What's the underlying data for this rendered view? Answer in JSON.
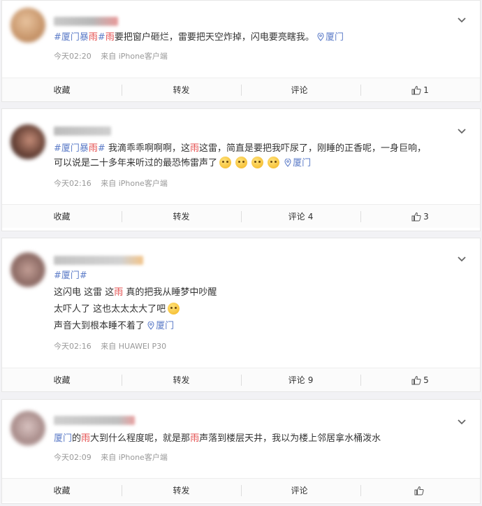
{
  "colors": {
    "tag": "#5e7dc8",
    "highlight": "#e34b4b",
    "meta": "#999999"
  },
  "posts": [
    {
      "segments": [
        {
          "t": "#厦门暴",
          "c": "tag"
        },
        {
          "t": "雨",
          "c": "hl"
        },
        {
          "t": "#",
          "c": "tag"
        },
        {
          "t": "雨",
          "c": "hl"
        },
        {
          "t": "要把窗户砸烂，雷要把天空炸掉，闪电要亮瞎我。",
          "c": ""
        }
      ],
      "location": "厦门",
      "time": "今天02:20",
      "source": "来自 iPhone客户端",
      "actions": {
        "favorite": "收藏",
        "repost": "转发",
        "comment": "评论",
        "comment_count": "",
        "like_count": "1"
      }
    },
    {
      "lines": [
        [
          {
            "t": "#厦门暴",
            "c": "tag"
          },
          {
            "t": "雨",
            "c": "hl"
          },
          {
            "t": "#",
            "c": "tag"
          },
          {
            "t": " 我滴乖乖啊啊啊，这",
            "c": ""
          },
          {
            "t": "雨",
            "c": "hl"
          },
          {
            "t": "这雷，简直是要把我吓尿了，刚睡的正香呢，一身巨响，",
            "c": ""
          }
        ],
        [
          {
            "t": "可以说是二十多年来听过的最恐怖雷声了",
            "c": ""
          }
        ]
      ],
      "location": "厦门",
      "time": "今天02:16",
      "source": "来自 iPhone客户端",
      "actions": {
        "favorite": "收藏",
        "repost": "转发",
        "comment": "评论",
        "comment_count": "4",
        "like_count": "3"
      }
    },
    {
      "lines": [
        [
          {
            "t": "#厦门#",
            "c": "tag"
          }
        ],
        [
          {
            "t": "这闪电 这雷 这",
            "c": ""
          },
          {
            "t": "雨",
            "c": "hl"
          },
          {
            "t": " 真的把我从睡梦中吵醒",
            "c": ""
          }
        ],
        [
          {
            "t": "太吓人了 这也太太太大了吧",
            "c": ""
          }
        ],
        [
          {
            "t": "声音大到根本睡不着了",
            "c": ""
          }
        ]
      ],
      "location": "厦门",
      "time": "今天02:16",
      "source": "来自 HUAWEI P30",
      "actions": {
        "favorite": "收藏",
        "repost": "转发",
        "comment": "评论",
        "comment_count": "9",
        "like_count": "5"
      }
    },
    {
      "segments": [
        {
          "t": "厦门",
          "c": "tag"
        },
        {
          "t": "的",
          "c": ""
        },
        {
          "t": "雨",
          "c": "hl"
        },
        {
          "t": "大到什么程度呢，就是那",
          "c": ""
        },
        {
          "t": "雨",
          "c": "hl"
        },
        {
          "t": "声落到楼层天井，我以为楼上邻居拿水桶泼水",
          "c": ""
        }
      ],
      "time": "今天02:09",
      "source": "来自 iPhone客户端",
      "actions": {
        "favorite": "收藏",
        "repost": "转发",
        "comment": "评论",
        "comment_count": "",
        "like_count": ""
      }
    }
  ]
}
